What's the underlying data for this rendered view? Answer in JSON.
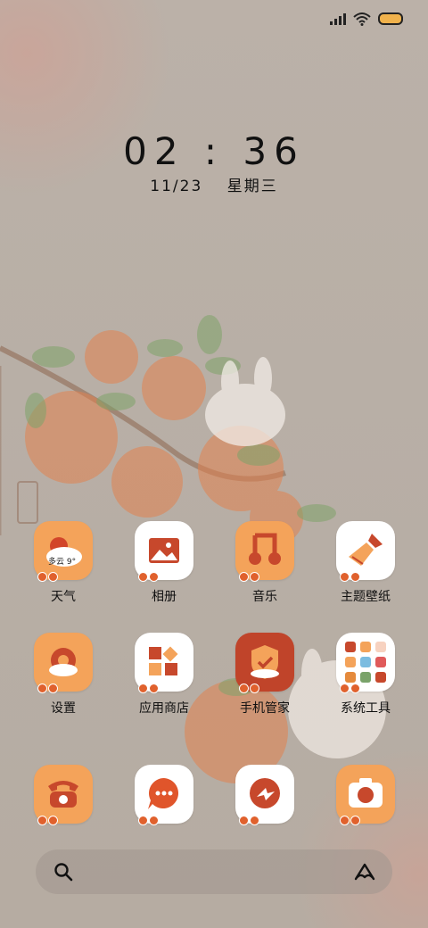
{
  "status_bar": {
    "signal_icon": "signal-icon",
    "wifi_icon": "wifi-icon",
    "battery_icon": "battery-icon",
    "battery_color": "#f0b24c"
  },
  "clock": {
    "time": "02 : 36",
    "date": "11/23",
    "weekday": "星期三"
  },
  "apps": [
    {
      "name": "weather",
      "label": "天气",
      "icon": "weather-icon",
      "icon_text": "多云 9°",
      "bg": "#f4a35a"
    },
    {
      "name": "gallery",
      "label": "相册",
      "icon": "gallery-icon",
      "bg": "#ffffff"
    },
    {
      "name": "music",
      "label": "音乐",
      "icon": "music-icon",
      "bg": "#f4a35a"
    },
    {
      "name": "themes",
      "label": "主题壁纸",
      "icon": "paintbrush-icon",
      "bg": "#ffffff"
    },
    {
      "name": "settings",
      "label": "设置",
      "icon": "gear-icon",
      "bg": "#f4a35a"
    },
    {
      "name": "app-store",
      "label": "应用商店",
      "icon": "app-store-icon",
      "bg": "#ffffff"
    },
    {
      "name": "security",
      "label": "手机管家",
      "icon": "shield-icon",
      "bg": "#c0442a"
    },
    {
      "name": "tools",
      "label": "系统工具",
      "icon": "tools-folder-icon",
      "bg": "#ffffff"
    }
  ],
  "dock": [
    {
      "name": "phone",
      "icon": "phone-icon",
      "bg": "#f4a35a"
    },
    {
      "name": "messages",
      "icon": "message-icon",
      "bg": "#ffffff"
    },
    {
      "name": "browser",
      "icon": "browser-icon",
      "bg": "#ffffff"
    },
    {
      "name": "camera",
      "icon": "camera-icon",
      "bg": "#f4a35a"
    }
  ],
  "search": {
    "search_icon": "search-icon",
    "assistant_icon": "assistant-icon"
  }
}
